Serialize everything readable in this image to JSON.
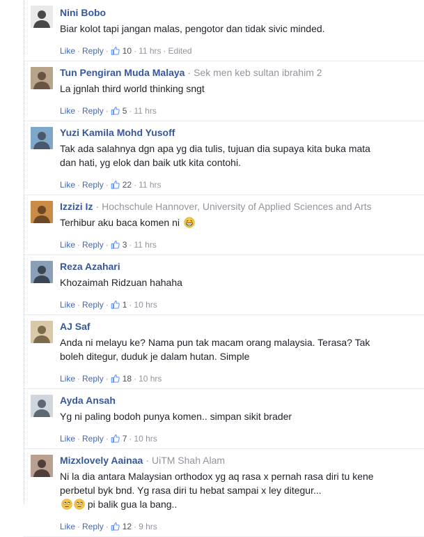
{
  "action_labels": {
    "like": "Like",
    "reply": "Reply",
    "separator": "·"
  },
  "comments": [
    {
      "author": "Nini Bobo",
      "affiliation": "",
      "text": "Biar kolot tapi jangan malas, pengotor dan tidak sivic minded.",
      "likes": "10",
      "time": "11 hrs",
      "edited": "Edited",
      "avatar_colors": [
        "#e9e9e9",
        "#2b2b2b"
      ]
    },
    {
      "author": "Tun Pengiran Muda Malaya",
      "affiliation": "Sek men keb sultan ibrahim 2",
      "text": "La jgnlah third world thinking sngt",
      "likes": "5",
      "time": "11 hrs",
      "avatar_colors": [
        "#b8a48a",
        "#5a4636"
      ]
    },
    {
      "author": "Yuzi Kamila Mohd Yusoff",
      "affiliation": "",
      "text": "Tak ada salahnya dgn apa yg dia tulis, tujuan dia supaya kita buka mata dan hati, yg elok dan baik utk kita contohi.",
      "likes": "22",
      "time": "11 hrs",
      "avatar_colors": [
        "#7fa7c9",
        "#3f4a5c"
      ]
    },
    {
      "author": "Izzizi Iz",
      "affiliation": "Hochschule Hannover, University of Applied Sciences and Arts",
      "text": "Terhibur aku baca komen ni",
      "emoji": "grin",
      "likes": "3",
      "time": "11 hrs",
      "avatar_colors": [
        "#c98b45",
        "#5b3b1e"
      ]
    },
    {
      "author": "Reza Azahari",
      "affiliation": "",
      "text": "Khozaimah Ridzuan hahaha",
      "likes": "1",
      "time": "10 hrs",
      "avatar_colors": [
        "#8aa0b8",
        "#2d3542"
      ]
    },
    {
      "author": "AJ Saf",
      "affiliation": "",
      "text": "Anda ni melayu ke? Nama pun tak macam orang malaysia. Terasa? Tak boleh ditegur, duduk je dalam hutan. Simple",
      "likes": "18",
      "time": "10 hrs",
      "avatar_colors": [
        "#d9c9a8",
        "#6b5a3a"
      ]
    },
    {
      "author": "Ayda Ansah",
      "affiliation": "",
      "text": "Yg ni paling bodoh punya komen.. simpan sikit brader",
      "likes": "7",
      "time": "10 hrs",
      "avatar_colors": [
        "#cfd6de",
        "#4a5563"
      ]
    },
    {
      "author": "Mizxlovely Aainaa",
      "affiliation": "UiTM Shah Alam",
      "text": "Ni la dia antara Malaysian orthodox yg aq rasa x pernah rasa diri tu kene perbetul byk bnd. Yg rasa diri tu hebat sampai x ley ditegur...",
      "text2": "pi balik gua la bang..",
      "emoji2": "rolleyes",
      "likes": "12",
      "time": "9 hrs",
      "avatar_colors": [
        "#b9a08f",
        "#3b2e2a"
      ]
    }
  ],
  "colors": {
    "link": "#365899",
    "action": "#4267b2",
    "meta": "#90949c",
    "like_icon": "#5890ff"
  }
}
